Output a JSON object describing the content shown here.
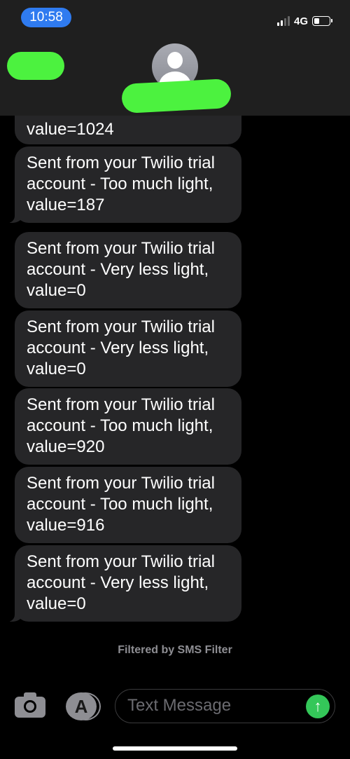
{
  "status": {
    "time": "10:58",
    "network": "4G",
    "battery_level": 0.3
  },
  "messages": [
    {
      "text": "value=1024"
    },
    {
      "text": "Sent from your Twilio trial account - Too much light, value=187"
    },
    {
      "text": "Sent from your Twilio trial account - Very less light, value=0"
    },
    {
      "text": "Sent from your Twilio trial account - Very less light, value=0"
    },
    {
      "text": "Sent from your Twilio trial account - Too much light, value=920"
    },
    {
      "text": "Sent from your Twilio trial account - Too much light, value=916"
    },
    {
      "text": "Sent from your Twilio trial account - Very less light, value=0"
    }
  ],
  "filter_note": "Filtered by SMS Filter",
  "composer": {
    "placeholder": "Text Message",
    "send_icon": "arrow-up-icon",
    "camera_icon": "camera-icon",
    "apps_icon": "app-store-icon"
  },
  "colors": {
    "bubble": "#262628",
    "accent": "#34c759",
    "time_pill": "#2f7bf0",
    "redaction": "#4cf23f"
  }
}
